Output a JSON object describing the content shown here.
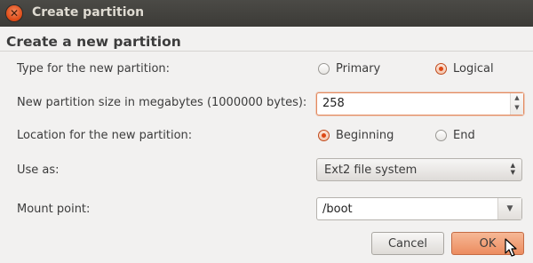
{
  "window": {
    "title": "Create partition"
  },
  "heading": "Create a new partition",
  "type": {
    "label": "Type for the new partition:",
    "options": [
      {
        "label": "Primary",
        "checked": false
      },
      {
        "label": "Logical",
        "checked": true
      }
    ]
  },
  "size": {
    "label": "New partition size in megabytes (1000000 bytes):",
    "value": "258"
  },
  "location": {
    "label": "Location for the new partition:",
    "options": [
      {
        "label": "Beginning",
        "checked": true
      },
      {
        "label": "End",
        "checked": false
      }
    ]
  },
  "use_as": {
    "label": "Use as:",
    "value": "Ext2 file system"
  },
  "mount": {
    "label": "Mount point:",
    "value": "/boot"
  },
  "buttons": {
    "cancel": "Cancel",
    "ok": "OK"
  },
  "colors": {
    "accent": "#dd4814",
    "titlebar": "#3c3b37",
    "background": "#f2f1f0"
  },
  "icons": {
    "close": "close-icon",
    "cursor": "mouse-pointer-icon"
  }
}
